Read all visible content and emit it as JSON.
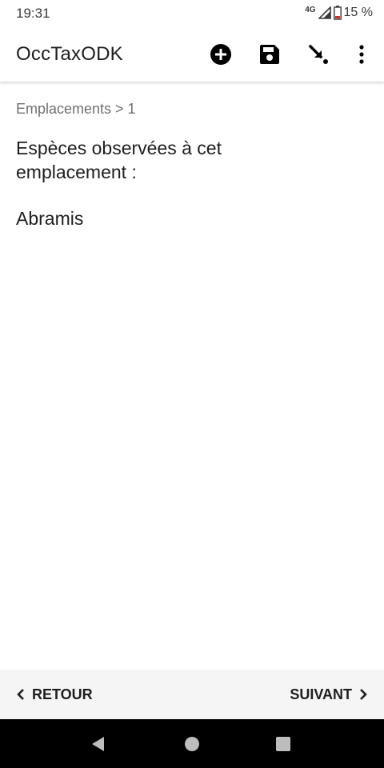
{
  "status_bar": {
    "time": "19:31",
    "network": "4G",
    "battery": "15 %"
  },
  "app_bar": {
    "title": "OccTaxODK",
    "actions": [
      "add-circle-icon",
      "save-icon",
      "goto-icon",
      "more-vertical-icon"
    ]
  },
  "form": {
    "breadcrumb": "Emplacements > 1",
    "question": "Espèces observées à cet emplacement :",
    "answer": "Abramis"
  },
  "bottom_nav": {
    "back_label": "RETOUR",
    "next_label": "SUIVANT"
  },
  "colors": {
    "bottom_bar": "#f5f5f5",
    "system_nav": "#000000",
    "breadcrumb": "#707070"
  }
}
